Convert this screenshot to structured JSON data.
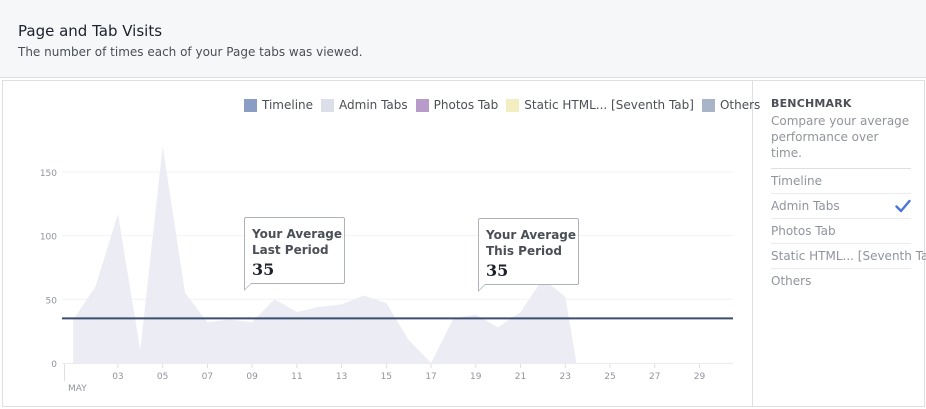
{
  "header": {
    "title": "Page and Tab Visits",
    "subtitle": "The number of times each of your Page tabs was viewed."
  },
  "legend": [
    {
      "label": "Timeline",
      "color": "#8b9dc3"
    },
    {
      "label": "Admin Tabs",
      "color": "#dcdfea"
    },
    {
      "label": "Photos Tab",
      "color": "#b99bc9"
    },
    {
      "label": "Static HTML... [Seventh Tab]",
      "color": "#f3eec0"
    },
    {
      "label": "Others",
      "color": "#a9b4c8"
    }
  ],
  "tooltips": {
    "last": {
      "line1": "Your Average",
      "line2": "Last Period",
      "value": "35"
    },
    "this": {
      "line1": "Your Average",
      "line2": "This Period",
      "value": "35"
    }
  },
  "benchmark": {
    "title": "BENCHMARK",
    "description": "Compare your average performance over time.",
    "items": [
      {
        "label": "Timeline",
        "checked": false
      },
      {
        "label": "Admin Tabs",
        "checked": true
      },
      {
        "label": "Photos Tab",
        "checked": false
      },
      {
        "label": "Static HTML... [Seventh Tab]",
        "checked": false
      },
      {
        "label": "Others",
        "checked": false
      }
    ]
  },
  "chart_data": {
    "type": "area",
    "month_label": "MAY",
    "x_ticks": [
      "03",
      "05",
      "07",
      "09",
      "11",
      "13",
      "15",
      "17",
      "19",
      "21",
      "23",
      "25",
      "27",
      "29"
    ],
    "y_ticks": [
      0,
      50,
      100,
      150
    ],
    "ylim": [
      0,
      175
    ],
    "xlim": [
      0.5,
      30.5
    ],
    "average_line": 35,
    "series": [
      {
        "name": "Admin Tabs",
        "color": "#ebecf4",
        "x": [
          1,
          2,
          3,
          4,
          5,
          6,
          7,
          8,
          9,
          10,
          11,
          12,
          13,
          14,
          15,
          16,
          17,
          18,
          19,
          20,
          21,
          22,
          23,
          23.5
        ],
        "values": [
          34,
          60,
          117,
          10,
          170,
          55,
          32,
          34,
          32,
          50,
          40,
          44,
          46,
          53,
          47,
          18,
          0,
          35,
          38,
          28,
          40,
          66,
          52,
          0
        ]
      }
    ]
  }
}
